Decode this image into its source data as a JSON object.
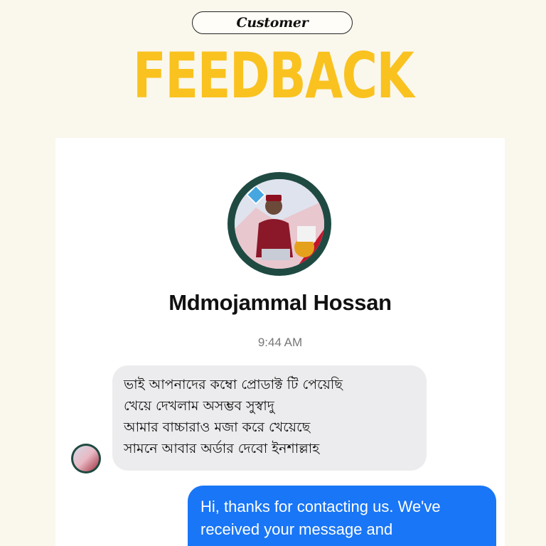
{
  "header": {
    "pill_label": "Customer",
    "headline": "FEEDBACK"
  },
  "chat": {
    "contact_name": "Mdmojammal Hossan",
    "timestamp": "9:44 AM",
    "incoming_message": {
      "lines": [
        "ভাই আপনাদের কম্বো প্রোডাক্ট টি পেয়েছি",
        "খেয়ে দেখলাম অসম্ভব সুস্বাদু",
        "আমার বাচ্চারাও মজা করে খেয়েছে",
        "সামনে আবার অর্ডার দেবো ইনশাল্লাহ"
      ]
    },
    "outgoing_message": {
      "lines": [
        "Hi, thanks for contacting us. We've",
        "received your message and"
      ]
    }
  },
  "colors": {
    "background": "#faf7ec",
    "headline": "#f9c21f",
    "outgoing_bubble": "#1976f6",
    "incoming_bubble": "#ececee",
    "avatar_ring": "#1f4a42"
  }
}
